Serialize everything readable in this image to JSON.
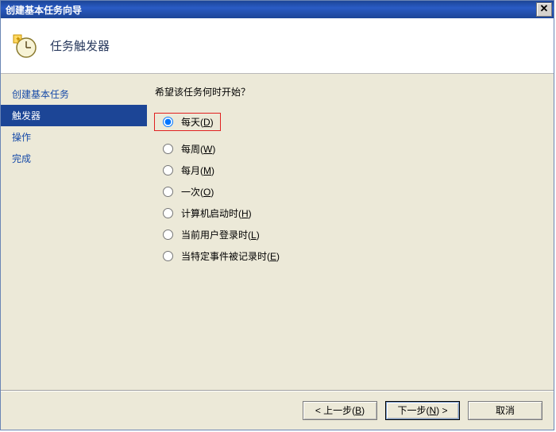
{
  "window": {
    "title": "创建基本任务向导"
  },
  "header": {
    "page_title": "任务触发器"
  },
  "sidebar": {
    "items": [
      {
        "label": "创建基本任务",
        "selected": false
      },
      {
        "label": "触发器",
        "selected": true
      },
      {
        "label": "操作",
        "selected": false
      },
      {
        "label": "完成",
        "selected": false
      }
    ]
  },
  "content": {
    "question": "希望该任务何时开始？",
    "options": [
      {
        "label_prefix": "每天(",
        "accel": "D",
        "label_suffix": ")",
        "checked": true,
        "highlighted": true
      },
      {
        "label_prefix": "每周(",
        "accel": "W",
        "label_suffix": ")",
        "checked": false,
        "highlighted": false
      },
      {
        "label_prefix": "每月(",
        "accel": "M",
        "label_suffix": ")",
        "checked": false,
        "highlighted": false
      },
      {
        "label_prefix": "一次(",
        "accel": "O",
        "label_suffix": ")",
        "checked": false,
        "highlighted": false
      },
      {
        "label_prefix": "计算机启动时(",
        "accel": "H",
        "label_suffix": ")",
        "checked": false,
        "highlighted": false
      },
      {
        "label_prefix": "当前用户登录时(",
        "accel": "L",
        "label_suffix": ")",
        "checked": false,
        "highlighted": false
      },
      {
        "label_prefix": "当特定事件被记录时(",
        "accel": "E",
        "label_suffix": ")",
        "checked": false,
        "highlighted": false
      }
    ]
  },
  "footer": {
    "back": {
      "pre": "< 上一步(",
      "accel": "B",
      "suf": ")"
    },
    "next": {
      "pre": "下一步(",
      "accel": "N",
      "suf": ") >"
    },
    "cancel": {
      "label": "取消"
    }
  }
}
